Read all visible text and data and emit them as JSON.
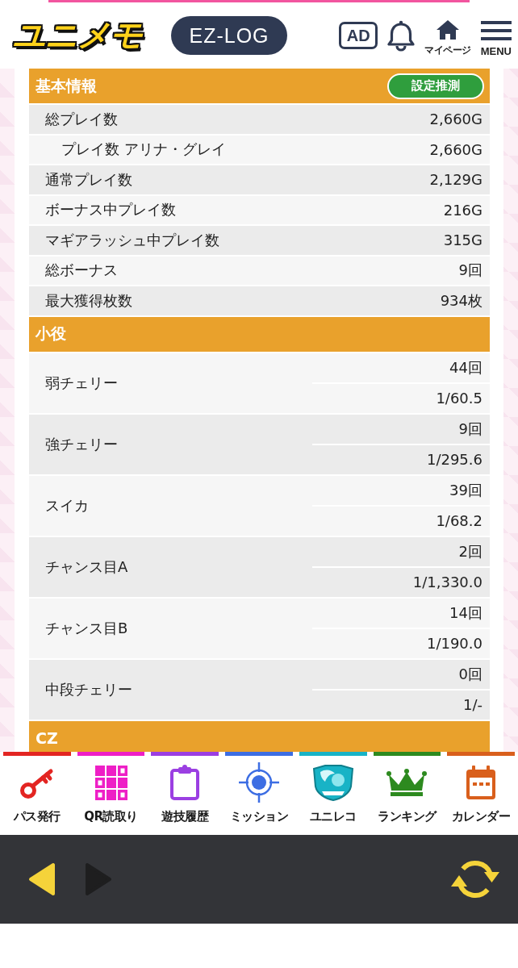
{
  "header": {
    "logo": "ユニメモ",
    "log_button": "EZ-LOG",
    "ad_button": "AD",
    "mypage_link": "マイページ",
    "menu_button": "MENU"
  },
  "sections": [
    {
      "title": "基本情報",
      "button": "設定推測",
      "rows": [
        {
          "label": "総プレイ数",
          "values": [
            "2,660G"
          ],
          "children": [
            {
              "label": "プレイ数 アリナ・グレイ",
              "values": [
                "2,660G"
              ]
            }
          ]
        },
        {
          "label": "通常プレイ数",
          "values": [
            "2,129G"
          ]
        },
        {
          "label": "ボーナス中プレイ数",
          "values": [
            "216G"
          ]
        },
        {
          "label": "マギアラッシュ中プレイ数",
          "values": [
            "315G"
          ]
        },
        {
          "label": "総ボーナス",
          "values": [
            "9回"
          ]
        },
        {
          "label": "最大獲得枚数",
          "values": [
            "934枚"
          ]
        }
      ]
    },
    {
      "title": "小役",
      "rows": [
        {
          "label": "弱チェリー",
          "values": [
            "44回",
            "1/60.5"
          ]
        },
        {
          "label": "強チェリー",
          "values": [
            "9回",
            "1/295.6"
          ]
        },
        {
          "label": "スイカ",
          "values": [
            "39回",
            "1/68.2"
          ]
        },
        {
          "label": "チャンス目A",
          "values": [
            "2回",
            "1/1,330.0"
          ]
        },
        {
          "label": "チャンス目B",
          "values": [
            "14回",
            "1/190.0"
          ]
        },
        {
          "label": "中段チェリー",
          "values": [
            "0回",
            "1/-"
          ]
        }
      ]
    },
    {
      "title": "CZ"
    }
  ],
  "bottom_nav": {
    "items": [
      {
        "label": "パス発行",
        "color": "#e32522"
      },
      {
        "label": "QR読取り",
        "color": "#ee1fc6"
      },
      {
        "label": "遊技履歴",
        "color": "#9b3fe2"
      },
      {
        "label": "ミッション",
        "color": "#3d6ee3"
      },
      {
        "label": "ユニレコ",
        "color": "#18b3c6"
      },
      {
        "label": "ランキング",
        "color": "#2d8a1f"
      },
      {
        "label": "カレンダー",
        "color": "#d95f1c"
      }
    ]
  },
  "browser_toolbar": {
    "back": {
      "disabled": false
    },
    "forward": {
      "disabled": true
    }
  }
}
